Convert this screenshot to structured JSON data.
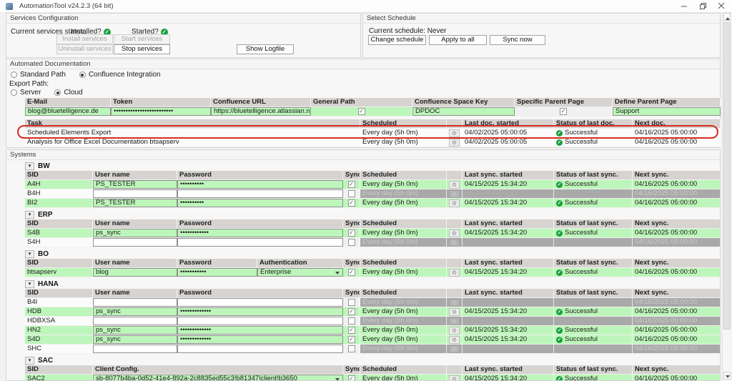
{
  "window": {
    "title": "AutomationTool v24.2.3 (64 bit)"
  },
  "services": {
    "title": "Services Configuration",
    "status_label": "Current services status:",
    "installed_label": "Installed?",
    "started_label": "Started?",
    "buttons": {
      "install": "Install services",
      "start": "Start services",
      "uninstall": "Uninstall services",
      "stop": "Stop services",
      "logfile": "Show Logfile"
    }
  },
  "schedule": {
    "title": "Select Schedule",
    "current_label": "Current schedule: Never",
    "buttons": {
      "change": "Change schedule",
      "apply": "Apply to all systems",
      "sync": "Sync now"
    }
  },
  "autodoc": {
    "title": "Automated Documentation",
    "radio_standard": "Standard Path",
    "radio_confluence": "Confluence Integration",
    "export_path_label": "Export Path:",
    "radio_server": "Server",
    "radio_cloud": "Cloud",
    "config_headers": [
      "E-Mail",
      "Token",
      "Confluence URL",
      "General Path",
      "Confluence Space Key",
      "Specific Parent Page",
      "Define Parent Page"
    ],
    "config_row": {
      "email": "blog@bluetelligence.de",
      "token_masked": "•••••••••••••••••••••••••",
      "url": "https://bluetelligence.atlassian.net",
      "general_path_checked": true,
      "space_key": "DPDOC",
      "specific_parent_checked": true,
      "parent_page": "Support"
    },
    "task_headers": [
      "Task",
      "Scheduled",
      "",
      "Last doc. started",
      "Status of last doc.",
      "Next doc."
    ],
    "tasks": [
      {
        "task": "Scheduled Elements Export",
        "scheduled": "Every day (5h 0m)",
        "last": "04/02/2025 05:00:05",
        "status": "Successful",
        "next": "04/16/2025 05:00:00",
        "annotated": true
      },
      {
        "task": "Analysis for Office Excel Documentation btsapserv",
        "scheduled": "Every day (5h 0m)",
        "last": "04/02/2025 05:00:05",
        "status": "Successful",
        "next": "04/16/2025 05:00:00",
        "annotated": false
      }
    ]
  },
  "systems": {
    "title": "Systems",
    "field_labels": {
      "sid": "SID",
      "user": "User name",
      "password": "Password",
      "auth": "Authentication",
      "config": "Client Config."
    },
    "shared_headers": {
      "sync": "Sync.",
      "scheduled": "Scheduled",
      "last": "Last sync. started",
      "status": "Status of last sync.",
      "next": "Next sync."
    },
    "groups": [
      {
        "name": "BW",
        "fields": [
          "sid",
          "user",
          "password"
        ],
        "rows": [
          {
            "active": true,
            "sid": "A4H",
            "user": "PS_TESTER",
            "password": "••••••••••",
            "sync": true,
            "scheduled": "Every day (5h 0m)",
            "last": "04/15/2025 15:34:20",
            "status": "Successful",
            "next": "04/16/2025 05:00:00"
          },
          {
            "active": false,
            "sid": "B4H",
            "user": "",
            "password": "",
            "sync": false,
            "scheduled": "Every day (5h 0m)",
            "last": "",
            "status": "",
            "next": "04/16/2025 05:00:00"
          },
          {
            "active": true,
            "sid": "BI2",
            "user": "PS_TESTER",
            "password": "••••••••••",
            "sync": true,
            "scheduled": "Every day (5h 0m)",
            "last": "04/15/2025 15:34:20",
            "status": "Successful",
            "next": "04/16/2025 05:00:00"
          }
        ]
      },
      {
        "name": "ERP",
        "fields": [
          "sid",
          "user",
          "password"
        ],
        "rows": [
          {
            "active": true,
            "sid": "S4B",
            "user": "ps_sync",
            "password": "••••••••••••",
            "sync": true,
            "scheduled": "Every day (5h 0m)",
            "last": "04/15/2025 15:34:20",
            "status": "Successful",
            "next": "04/16/2025 05:00:00"
          },
          {
            "active": false,
            "sid": "S4H",
            "user": "",
            "password": "",
            "sync": false,
            "scheduled": "Every day (5h 0m)",
            "last": "",
            "status": "",
            "next": "04/16/2025 05:00:00"
          }
        ]
      },
      {
        "name": "BO",
        "fields": [
          "sid",
          "user",
          "password",
          "auth"
        ],
        "rows": [
          {
            "active": true,
            "sid": "btsapserv",
            "user": "blog",
            "password": "•••••••••••",
            "auth": "Enterprise",
            "sync": true,
            "scheduled": "Every day (5h 0m)",
            "last": "04/15/2025 15:34:20",
            "status": "Successful",
            "next": "04/16/2025 05:00:00"
          }
        ]
      },
      {
        "name": "HANA",
        "fields": [
          "sid",
          "user",
          "password"
        ],
        "rows": [
          {
            "active": false,
            "sid": "B4I",
            "user": "",
            "password": "",
            "sync": false,
            "scheduled": "Every day (5h 0m)",
            "last": "",
            "status": "",
            "next": "04/16/2025 05:00:00"
          },
          {
            "active": true,
            "sid": "HDB",
            "user": "ps_sync",
            "password": "•••••••••••••",
            "sync": true,
            "scheduled": "Every day (5h 0m)",
            "last": "04/15/2025 15:34:20",
            "status": "Successful",
            "next": "04/16/2025 05:00:00"
          },
          {
            "active": false,
            "sid": "HDBXSA",
            "user": "",
            "password": "",
            "sync": false,
            "scheduled": "Every day (5h 0m)",
            "last": "",
            "status": "",
            "next": "04/16/2025 05:00:00"
          },
          {
            "active": true,
            "sid": "HN2",
            "user": "ps_sync",
            "password": "•••••••••••••",
            "sync": true,
            "scheduled": "Every day (5h 0m)",
            "last": "04/15/2025 15:34:20",
            "status": "Successful",
            "next": "04/16/2025 05:00:00"
          },
          {
            "active": true,
            "sid": "S4D",
            "user": "ps_sync",
            "password": "•••••••••••••",
            "sync": true,
            "scheduled": "Every day (5h 0m)",
            "last": "04/15/2025 15:34:20",
            "status": "Successful",
            "next": "04/16/2025 05:00:00"
          },
          {
            "active": false,
            "sid": "SHC",
            "user": "",
            "password": "",
            "sync": false,
            "scheduled": "Every day (5h 0m)",
            "last": "",
            "status": "",
            "next": "04/16/2025 05:00:00"
          }
        ]
      },
      {
        "name": "SAC",
        "fields": [
          "sid",
          "config"
        ],
        "rows": [
          {
            "active": true,
            "sid": "SAC2",
            "config": "sb-8077b4ba-0d52-41e4-892a-2c8835ed55c3!b81347|client!b3650",
            "sync": true,
            "scheduled": "Every day (5h 0m)",
            "last": "04/15/2025 15:34:20",
            "status": "Successful",
            "next": "04/16/2025 05:00:00"
          }
        ]
      }
    ]
  },
  "annotation": {
    "shape": "ellipse",
    "color": "#d92b1f",
    "target": "first task row"
  },
  "colors": {
    "row_active_green": "#bdf6ba",
    "row_disabled_gray": "#a9a9a9",
    "table_header_gray": "#d6d3d0",
    "success_green": "#17a03a",
    "annotation_red": "#d92b1f"
  }
}
